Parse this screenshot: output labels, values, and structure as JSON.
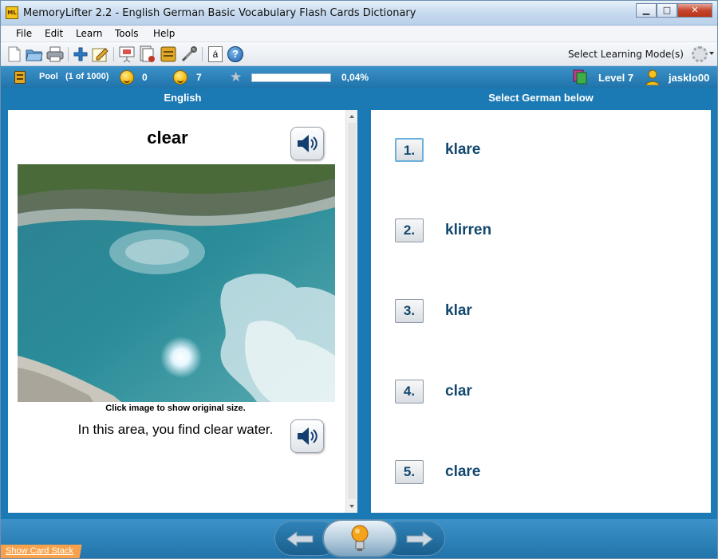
{
  "window": {
    "title": "MemoryLifter 2.2 - English German Basic Vocabulary Flash Cards Dictionary",
    "app_icon_text": "ML",
    "minimize_glyph": "▁",
    "maximize_glyph": "□",
    "close_glyph": "✕"
  },
  "menu": [
    "File",
    "Edit",
    "Learn",
    "Tools",
    "Help"
  ],
  "toolbar": {
    "icons": [
      "new-icon",
      "open-icon",
      "print-icon",
      "add-icon",
      "edit-icon",
      "slideshow-icon",
      "statistics-icon",
      "box-icon",
      "settings-icon",
      "character-map-icon",
      "help-icon"
    ],
    "charmap_glyph": "á",
    "help_glyph": "?",
    "learning_mode_label": "Select Learning Mode(s)"
  },
  "status": {
    "pool_label": "Pool",
    "pool_count": "(1 of 1000)",
    "right_count": "0",
    "wrong_count": "7",
    "progress_percent": 0.04,
    "progress_text": "0,04%",
    "level": "Level 7",
    "user": "jasklo00"
  },
  "card": {
    "question_header": "English",
    "answer_header": "Select German below",
    "word": "clear",
    "image_caption": "Click image to show original size.",
    "example": "In this area, you find clear water."
  },
  "answers": [
    {
      "number": "1.",
      "text": "klare",
      "selected": true
    },
    {
      "number": "2.",
      "text": "klirren",
      "selected": false
    },
    {
      "number": "3.",
      "text": "klar",
      "selected": false
    },
    {
      "number": "4.",
      "text": "clar",
      "selected": false
    },
    {
      "number": "5.",
      "text": "clare",
      "selected": false
    }
  ],
  "bottom": {
    "show_card_stack": "Show Card Stack"
  },
  "colors": {
    "accent_blue": "#1b7ab4",
    "answer_text": "#11476e",
    "show_stack_orange": "#f7a24a"
  }
}
